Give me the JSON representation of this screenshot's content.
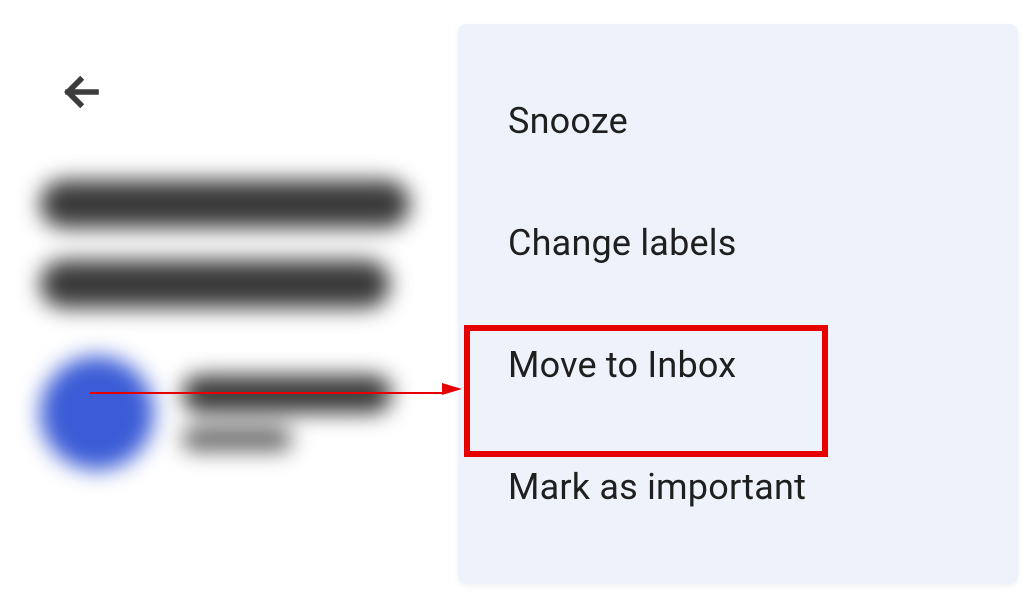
{
  "menu": {
    "items": [
      {
        "label": "Snooze"
      },
      {
        "label": "Change labels"
      },
      {
        "label": "Move to Inbox"
      },
      {
        "label": "Mark as important"
      }
    ]
  }
}
